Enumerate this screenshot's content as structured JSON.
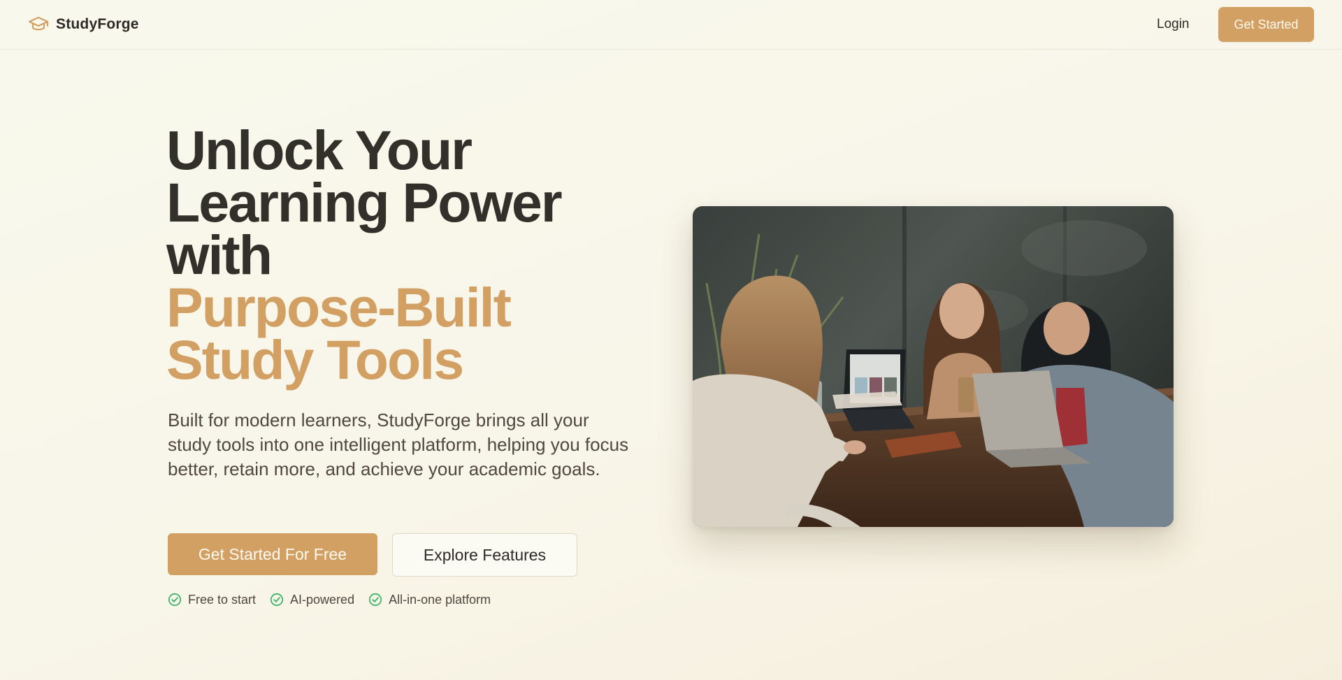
{
  "header": {
    "brand_name": "StudyForge",
    "brand_icon": "graduation-cap-icon",
    "login_label": "Login",
    "cta_label": "Get Started"
  },
  "hero": {
    "title_lines": [
      "Unlock Your",
      "Learning Power",
      "with"
    ],
    "title_accent_lines": [
      "Purpose-Built",
      "Study Tools"
    ],
    "subtitle": "Built for modern learners, StudyForge brings all your study tools into one intelligent platform, helping you focus better, retain more, and achieve your academic goals.",
    "primary_button": "Get Started For Free",
    "secondary_button": "Explore Features",
    "features": [
      "Free to start",
      "AI-powered",
      "All-in-one platform"
    ],
    "feature_icon": "check-circle-icon",
    "image": "students-studying-with-laptops-photo"
  },
  "colors": {
    "accent": "#d3a064",
    "heading": "#332f2b",
    "body_text": "#4f4740",
    "background": "#f8f8ec",
    "check_green": "#3fb46a"
  }
}
